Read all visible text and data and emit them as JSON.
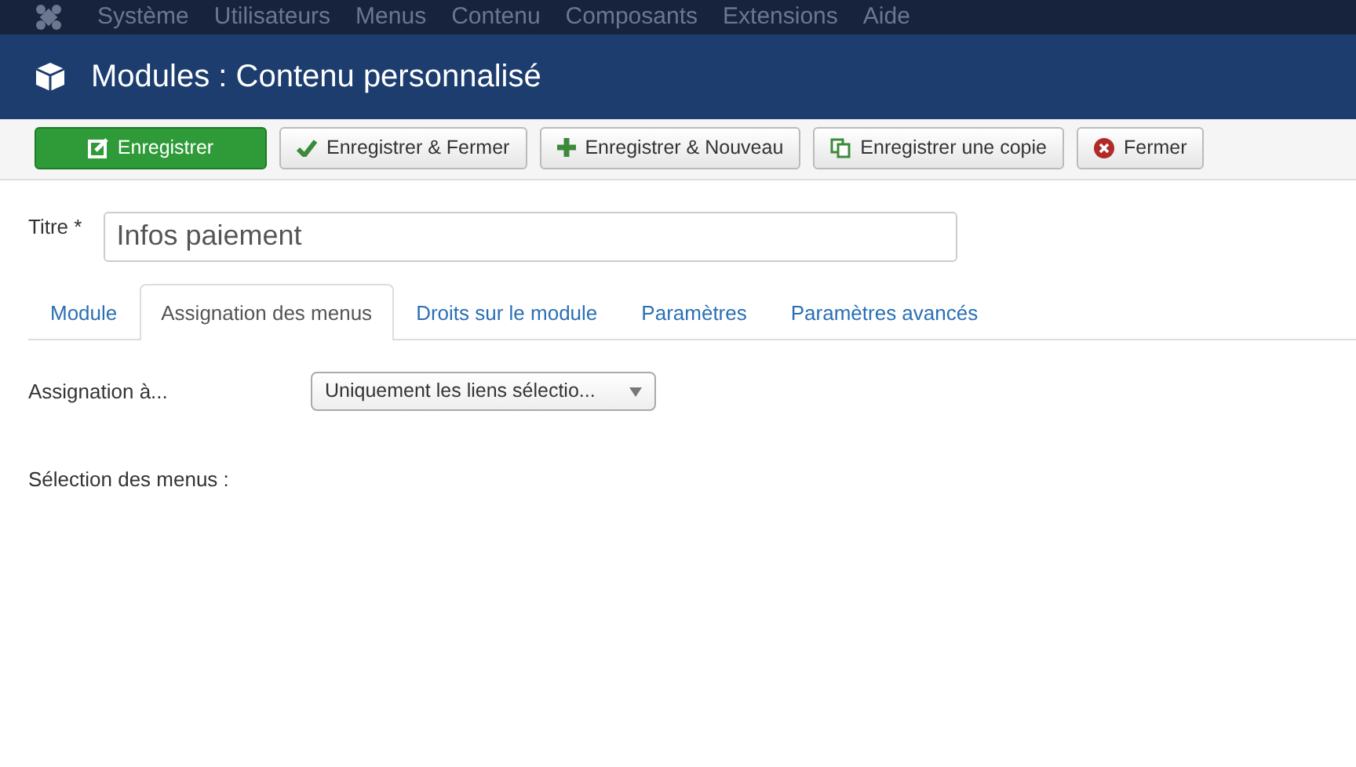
{
  "menu": [
    {
      "label": "Système"
    },
    {
      "label": "Utilisateurs"
    },
    {
      "label": "Menus"
    },
    {
      "label": "Contenu"
    },
    {
      "label": "Composants"
    },
    {
      "label": "Extensions"
    },
    {
      "label": "Aide"
    }
  ],
  "header": {
    "title": "Modules : Contenu personnalisé"
  },
  "toolbar": [
    {
      "label": "Enregistrer",
      "kind": "edit",
      "primary": true
    },
    {
      "label": "Enregistrer & Fermer",
      "kind": "check",
      "primary": false
    },
    {
      "label": "Enregistrer & Nouveau",
      "kind": "plus",
      "primary": false
    },
    {
      "label": "Enregistrer une copie",
      "kind": "copy",
      "primary": false
    },
    {
      "label": "Fermer",
      "kind": "close",
      "primary": false
    }
  ],
  "title_field": {
    "label": "Titre *",
    "value": "Infos paiement"
  },
  "tabs": [
    {
      "label": "Module",
      "selected": false
    },
    {
      "label": "Assignation des menus",
      "selected": true
    },
    {
      "label": "Droits sur le module",
      "selected": false
    },
    {
      "label": "Paramètres",
      "selected": false
    },
    {
      "label": "Paramètres avancés",
      "selected": false
    }
  ],
  "assignment": {
    "label": "Assignation à...",
    "value": "Uniquement les liens sélectio..."
  },
  "menu_selection": {
    "label": "Sélection des menus :"
  }
}
